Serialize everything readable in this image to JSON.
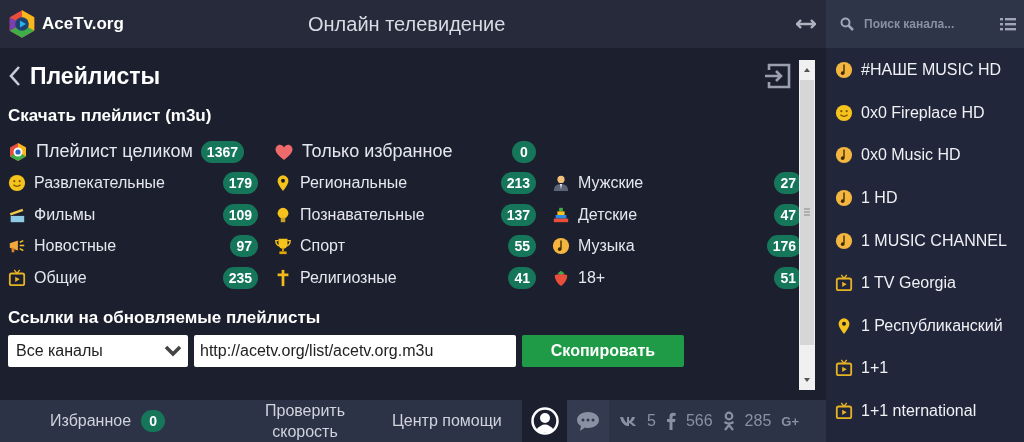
{
  "header": {
    "logo_text": "AceTv.org",
    "title": "Онлайн телевидение"
  },
  "search": {
    "placeholder": "Поиск канала..."
  },
  "page": {
    "title": "Плейлисты"
  },
  "download": {
    "heading": "Скачать плейлист (m3u)",
    "top": [
      {
        "kind": "all",
        "label": "Плейлист целиком",
        "count": "1367"
      },
      {
        "kind": "heart",
        "label": "Только избранное",
        "count": "0"
      }
    ],
    "columns": [
      [
        {
          "kind": "smile",
          "label": "Развлекательные",
          "count": "179"
        },
        {
          "kind": "film",
          "label": "Фильмы",
          "count": "109"
        },
        {
          "kind": "megaphone",
          "label": "Новостные",
          "count": "97"
        },
        {
          "kind": "tv",
          "label": "Общие",
          "count": "235"
        }
      ],
      [
        {
          "kind": "pin",
          "label": "Региональные",
          "count": "213"
        },
        {
          "kind": "bulb",
          "label": "Познавательные",
          "count": "137"
        },
        {
          "kind": "trophy",
          "label": "Спорт",
          "count": "55"
        },
        {
          "kind": "cross",
          "label": "Религиозные",
          "count": "41"
        }
      ],
      [
        {
          "kind": "man",
          "label": "Мужские",
          "count": "27"
        },
        {
          "kind": "pyramid",
          "label": "Детские",
          "count": "47"
        },
        {
          "kind": "music",
          "label": "Музыка",
          "count": "176"
        },
        {
          "kind": "strawberry",
          "label": "18+",
          "count": "51"
        }
      ]
    ]
  },
  "links": {
    "heading": "Ссылки на обновляемые плейлисты",
    "select_value": "Все каналы",
    "url": "http://acetv.org/list/acetv.org.m3u",
    "copy_button": "Скопировать"
  },
  "bottom_bar": {
    "favorites": "Избранное",
    "favorites_count": "0",
    "speed_test": "Проверить скорость",
    "help": "Центр помощи",
    "social": [
      {
        "kind": "vk",
        "count": "5"
      },
      {
        "kind": "fb",
        "count": "566"
      },
      {
        "kind": "ok",
        "count": "285"
      }
    ],
    "gplus": "G+"
  },
  "channels": [
    {
      "kind": "music",
      "name": "#НАШЕ MUSIC HD"
    },
    {
      "kind": "smile",
      "name": "0x0 Fireplace HD"
    },
    {
      "kind": "music",
      "name": "0x0 Music HD"
    },
    {
      "kind": "music",
      "name": "1 HD"
    },
    {
      "kind": "music",
      "name": "1 MUSIC CHANNEL"
    },
    {
      "kind": "tv",
      "name": "1 TV Georgia"
    },
    {
      "kind": "pin",
      "name": "1 Республиканский"
    },
    {
      "kind": "tv",
      "name": "1+1"
    },
    {
      "kind": "tv",
      "name": "1+1 nternational"
    }
  ]
}
